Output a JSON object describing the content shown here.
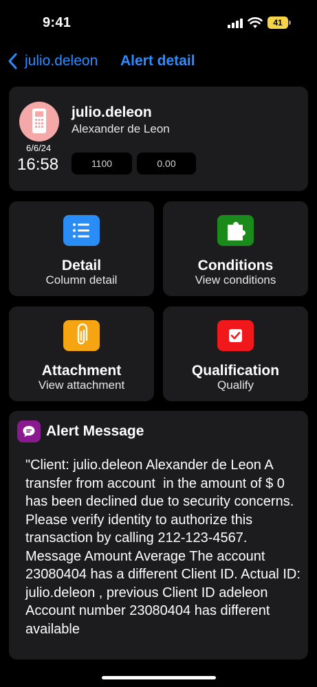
{
  "status_bar": {
    "time": "9:41",
    "battery_level": "41",
    "icons": [
      "signal-icon",
      "wifi-icon",
      "battery-icon"
    ]
  },
  "nav": {
    "back_label": "julio.deleon",
    "title": "Alert detail"
  },
  "header": {
    "username": "julio.deleon",
    "full_name": "Alexander de Leon",
    "date": "6/6/24",
    "time": "16:58",
    "pill_1": "1100",
    "pill_2": "0.00",
    "avatar_icon": "card-terminal-icon"
  },
  "tiles": [
    {
      "title": "Detail",
      "subtitle": "Column detail",
      "icon": "list-icon",
      "color": "#2a8cf5"
    },
    {
      "title": "Conditions",
      "subtitle": "View conditions",
      "icon": "puzzle-icon",
      "color": "#1a8a1a"
    },
    {
      "title": "Attachment",
      "subtitle": "View attachment",
      "icon": "paperclip-icon",
      "color": "#f5a511"
    },
    {
      "title": "Qualification",
      "subtitle": "Qualify",
      "icon": "checkbox-icon",
      "color": "#f0181a"
    }
  ],
  "message": {
    "title": "Alert Message",
    "icon": "chat-bubble-icon",
    "body": "\"Client: julio.deleon Alexander de Leon A transfer from account  in the amount of $ 0   has been declined due to security concerns. Please verify identity to authorize this transaction by calling 212-123-4567. Message Amount Average The account 23080404 has a different Client ID. Actual ID: julio.deleon , previous Client ID adeleon  Account number 23080404 has different available"
  },
  "colors": {
    "accent": "#2d8cff",
    "card_bg": "#1c1c1e",
    "avatar_bg": "#f4a9a8",
    "message_icon_bg": "#8a1a8f"
  }
}
